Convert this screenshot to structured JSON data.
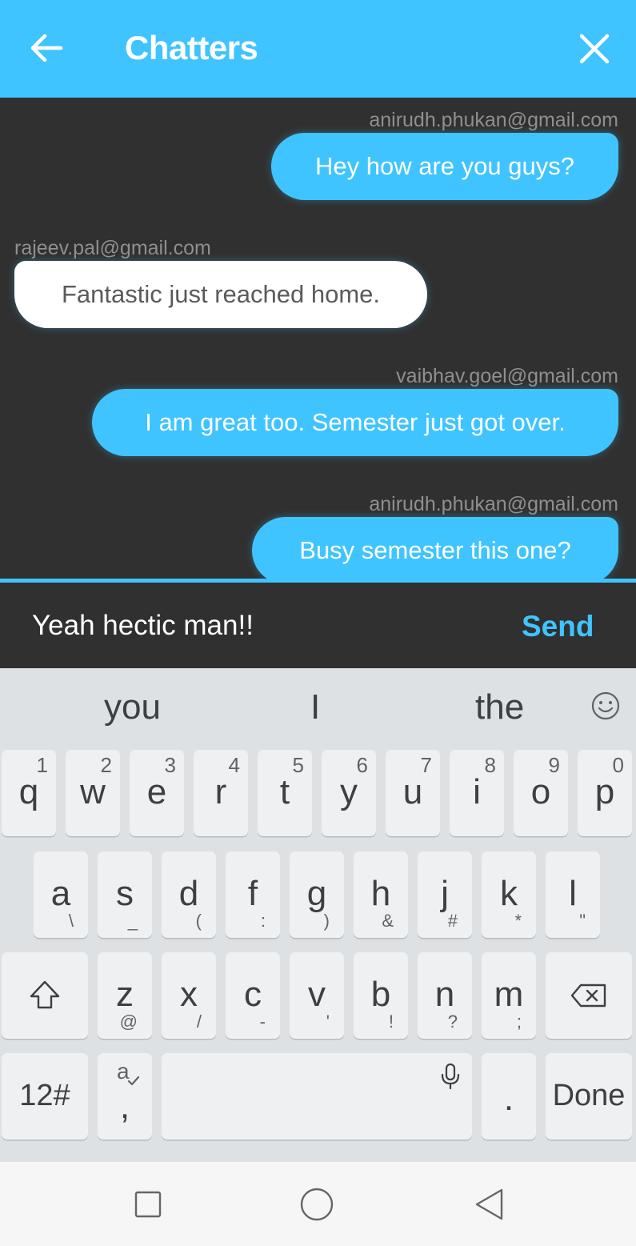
{
  "appbar": {
    "title": "Chatters",
    "back_icon": "arrow-left-icon",
    "close_icon": "close-icon"
  },
  "messages": [
    {
      "sender": "anirudh.phukan@gmail.com",
      "text": "Hey how are you guys?",
      "side": "right"
    },
    {
      "sender": "rajeev.pal@gmail.com",
      "text": "Fantastic just reached home.",
      "side": "left"
    },
    {
      "sender": "vaibhav.goel@gmail.com",
      "text": "I am great too. Semester just got over.",
      "side": "right"
    },
    {
      "sender": "anirudh.phukan@gmail.com",
      "text": "Busy semester this one?",
      "side": "right"
    }
  ],
  "composer": {
    "value": "Yeah hectic man!!",
    "send_label": "Send"
  },
  "keyboard": {
    "suggestions": [
      "you",
      "I",
      "the"
    ],
    "row1": [
      {
        "key": "q",
        "num": "1"
      },
      {
        "key": "w",
        "num": "2"
      },
      {
        "key": "e",
        "num": "3"
      },
      {
        "key": "r",
        "num": "4"
      },
      {
        "key": "t",
        "num": "5"
      },
      {
        "key": "y",
        "num": "6"
      },
      {
        "key": "u",
        "num": "7"
      },
      {
        "key": "i",
        "num": "8"
      },
      {
        "key": "o",
        "num": "9"
      },
      {
        "key": "p",
        "num": "0"
      }
    ],
    "row2": [
      {
        "key": "a",
        "sub": "\\"
      },
      {
        "key": "s",
        "sub": "_"
      },
      {
        "key": "d",
        "sub": "("
      },
      {
        "key": "f",
        "sub": ":"
      },
      {
        "key": "g",
        "sub": ")"
      },
      {
        "key": "h",
        "sub": "&"
      },
      {
        "key": "j",
        "sub": "#"
      },
      {
        "key": "k",
        "sub": "*"
      },
      {
        "key": "l",
        "sub": "\""
      }
    ],
    "row3": [
      {
        "key": "z",
        "sub": "@"
      },
      {
        "key": "x",
        "sub": "/"
      },
      {
        "key": "c",
        "sub": "-"
      },
      {
        "key": "v",
        "sub": "'"
      },
      {
        "key": "b",
        "sub": "!"
      },
      {
        "key": "n",
        "sub": "?"
      },
      {
        "key": "m",
        "sub": ";"
      }
    ],
    "symbols_label": "12#",
    "comma_key": ",",
    "period_key": ".",
    "done_label": "Done"
  },
  "colors": {
    "accent": "#40c4ff",
    "chat_bg": "#303030",
    "keyboard_bg": "#dde1e4"
  }
}
